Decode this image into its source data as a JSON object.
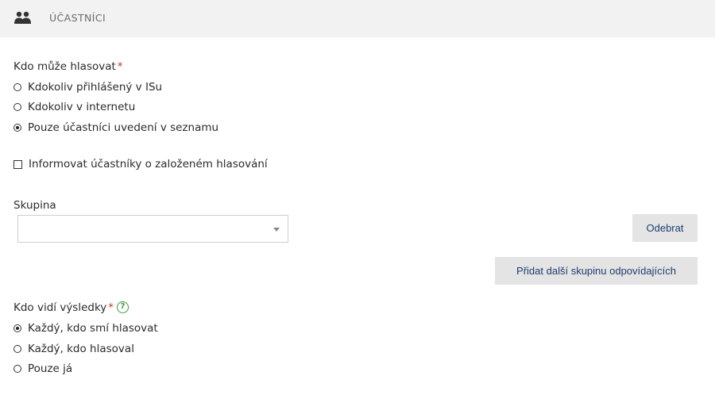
{
  "header": {
    "title": "ÚČASTNÍCI",
    "icon": "users-icon"
  },
  "voters": {
    "label": "Kdo může hlasovat",
    "required_mark": "*",
    "options": [
      {
        "label": "Kdokoliv přihlášený v ISu",
        "checked": false
      },
      {
        "label": "Kdokoliv v internetu",
        "checked": false
      },
      {
        "label": "Pouze účastníci uvedení v seznamu",
        "checked": true
      }
    ]
  },
  "notify": {
    "label": "Informovat účastníky o založeném hlasování",
    "checked": false
  },
  "group": {
    "label": "Skupina",
    "selected_value": ""
  },
  "buttons": {
    "remove_label": "Odebrat",
    "add_group_label": "Přidat další skupinu odpovídajících"
  },
  "results": {
    "label": "Kdo vidí výsledky",
    "required_mark": "*",
    "help_icon": "question-circle-icon",
    "help_glyph": "?",
    "options": [
      {
        "label": "Každý, kdo smí hlasovat",
        "checked": true
      },
      {
        "label": "Každý, kdo hlasoval",
        "checked": false
      },
      {
        "label": "Pouze já",
        "checked": false
      }
    ]
  },
  "colors": {
    "required": "#c0392b",
    "button_text": "#1d3d6e",
    "help": "#3a9a3a",
    "header_bg": "#f2f2f2"
  }
}
